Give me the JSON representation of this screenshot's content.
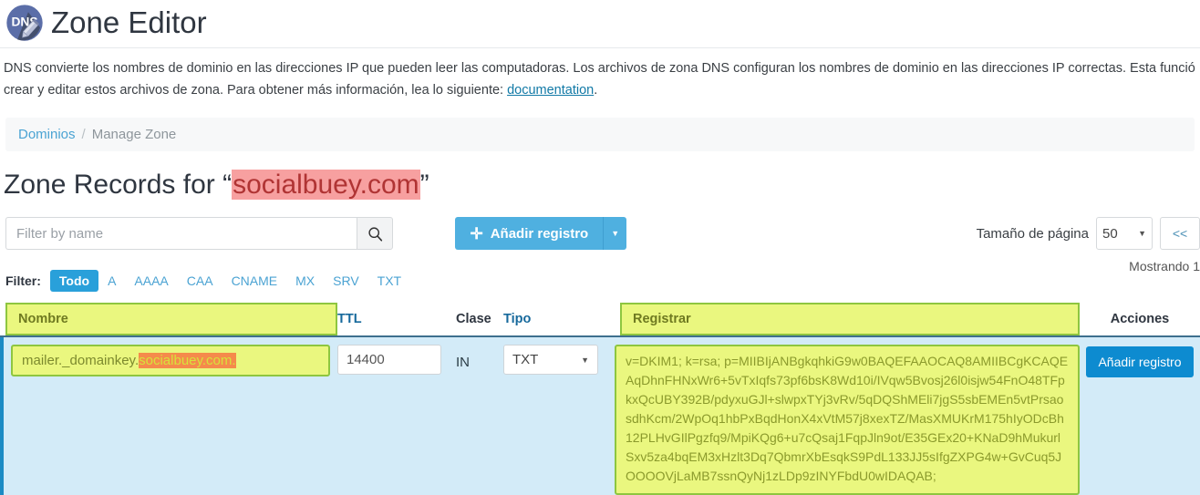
{
  "header": {
    "logo_text": "DNS",
    "title": "Zone Editor"
  },
  "description": {
    "line1": "DNS convierte los nombres de dominio en las direcciones IP que pueden leer las computadoras. Los archivos de zona DNS configuran los nombres de dominio en las direcciones IP correctas. Esta funció",
    "line2_prefix": "crear y editar estos archivos de zona. Para obtener más información, lea lo siguiente: ",
    "link_text": "documentation",
    "line2_suffix": "."
  },
  "breadcrumb": {
    "root": "Dominios",
    "separator": "/",
    "current": "Manage Zone"
  },
  "zone_title": {
    "prefix": "Zone Records for “",
    "domain": "socialbuey.com",
    "suffix": "”",
    "highlight_color": "#f7a0a0"
  },
  "toolbar": {
    "filter_placeholder": "Filter by name",
    "filter_value": "",
    "search_icon": "search-icon",
    "add_record_label": "Añadir registro",
    "add_record_plus": "✛",
    "add_caret": "▼"
  },
  "pagination": {
    "page_size_label": "Tamaño de página",
    "page_size_value": "50",
    "page_size_caret": "▼",
    "prev_label": "<<",
    "showing_text": "Mostrando 1"
  },
  "filters": {
    "label": "Filter:",
    "items": [
      {
        "label": "Todo",
        "active": true
      },
      {
        "label": "A",
        "active": false
      },
      {
        "label": "AAAA",
        "active": false
      },
      {
        "label": "CAA",
        "active": false
      },
      {
        "label": "CNAME",
        "active": false
      },
      {
        "label": "MX",
        "active": false
      },
      {
        "label": "SRV",
        "active": false
      },
      {
        "label": "TXT",
        "active": false
      }
    ]
  },
  "table": {
    "headers": {
      "nombre": "Nombre",
      "ttl": "TTL",
      "clase": "Clase",
      "tipo": "Tipo",
      "registrar": "Registrar",
      "acciones": "Acciones"
    },
    "row": {
      "name_prefix": "mailer._domainkey.",
      "name_domain": "socialbuey.com.",
      "ttl": "14400",
      "clase": "IN",
      "tipo": "TXT",
      "tipo_caret": "▼",
      "registrar": "v=DKIM1; k=rsa; p=MIIBIjANBgkqhkiG9w0BAQEFAAOCAQ8AMIIBCgKCAQEAqDhnFHNxWr6+5vTxIqfs73pf6bsK8Wd10i/IVqw5Bvosj26l0isjw54FnO48TFpkxQcUBY392B/pdyxuGJl+slwpxTYj3vRv/5qDQShMEli7jgS5sbEMEn5vtPrsaosdhKcm/2WpOq1hbPxBqdHonX4xVtM57j8xexTZ/MasXMUKrM175hIyODcBh12PLHvGIlPgzfq9/MpiKQg6+u7cQsaj1FqpJln9ot/E35GEx20+KNaD9hMukurlSxv5za4bqEM3xHzlt3Dq7QbmrXbEsqkS9PdL133JJ5sIfgZXPG4w+GvCuq5JOOOOVjLaMB7ssnQyNj1zLDp9zINYFbdU0wIDAQAB;",
      "accion_label": "Añadir registro"
    }
  },
  "colors": {
    "accent_blue": "#4fb0e0",
    "active_tab": "#29a0da",
    "highlight_yellow": "#eaf77f",
    "highlight_green_border": "#8ec640",
    "highlight_orange": "#f58a4b",
    "row_blue": "#d3ebf8"
  }
}
